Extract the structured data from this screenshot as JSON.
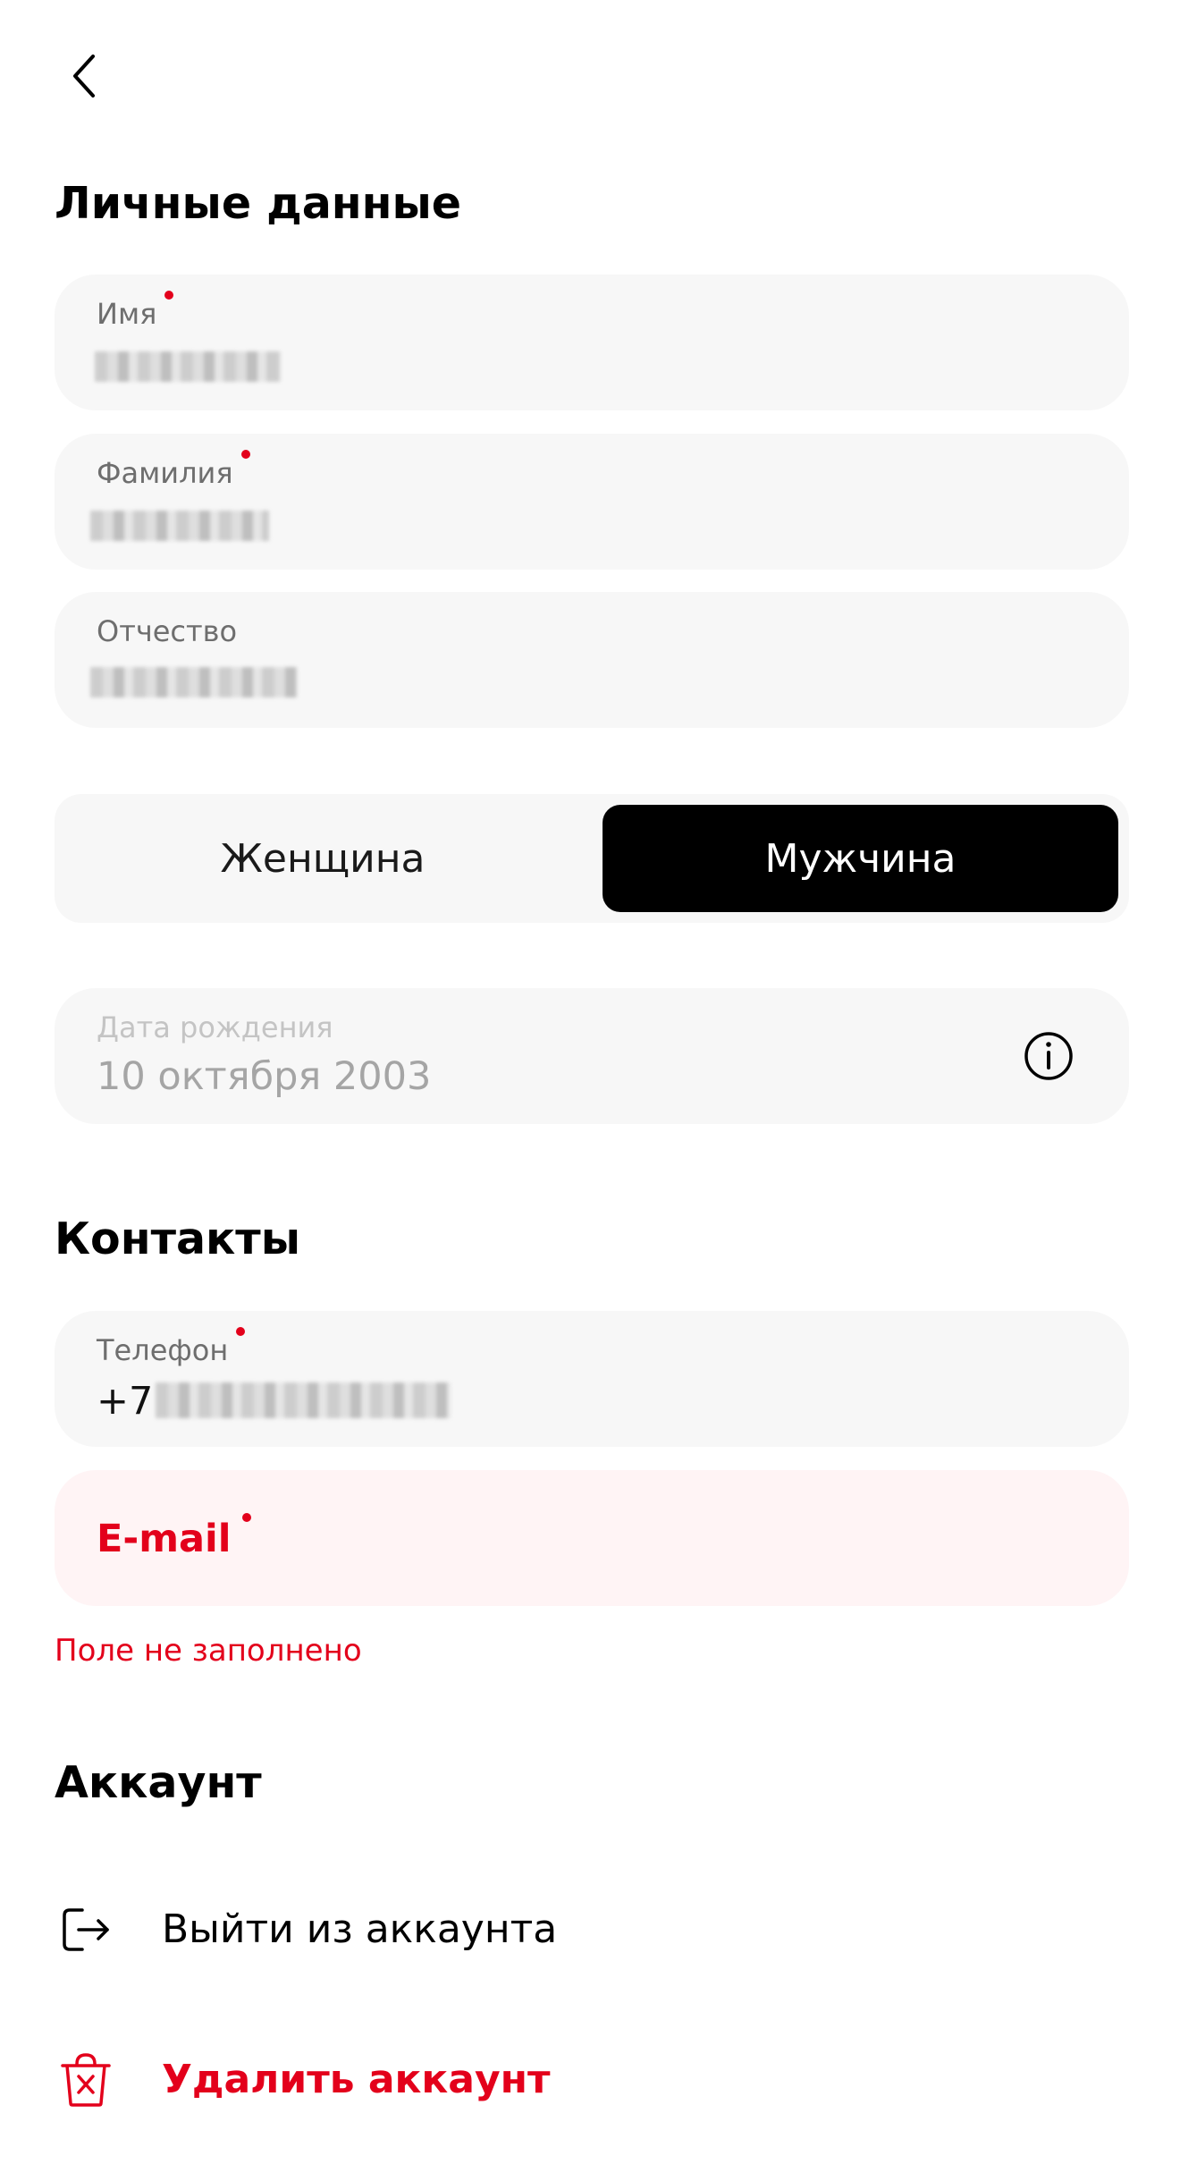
{
  "header": {
    "back_icon": "chevron-left-icon"
  },
  "personal": {
    "title": "Личные данные",
    "first_name": {
      "label": "Имя",
      "required": true
    },
    "last_name": {
      "label": "Фамилия",
      "required": true
    },
    "patronymic": {
      "label": "Отчество",
      "required": false
    }
  },
  "gender": {
    "options": [
      "Женщина",
      "Мужчина"
    ],
    "selected": "Мужчина"
  },
  "birth_date": {
    "label": "Дата рождения",
    "value": "10 октября 2003",
    "icon": "info-icon"
  },
  "contacts": {
    "title": "Контакты",
    "phone": {
      "label": "Телефон",
      "prefix": "+7",
      "required": true
    },
    "email": {
      "label": "E-mail",
      "required": true,
      "error": "Поле не заполнено"
    }
  },
  "account": {
    "title": "Аккаунт",
    "logout": {
      "label": "Выйти из аккаунта",
      "icon": "logout-icon"
    },
    "delete": {
      "label": "Удалить аккаунт",
      "icon": "trash-icon"
    }
  },
  "colors": {
    "accent": "#e3001b",
    "field_bg": "#f7f7f7",
    "error_bg": "#fff4f5",
    "selected_bg": "#000000"
  }
}
